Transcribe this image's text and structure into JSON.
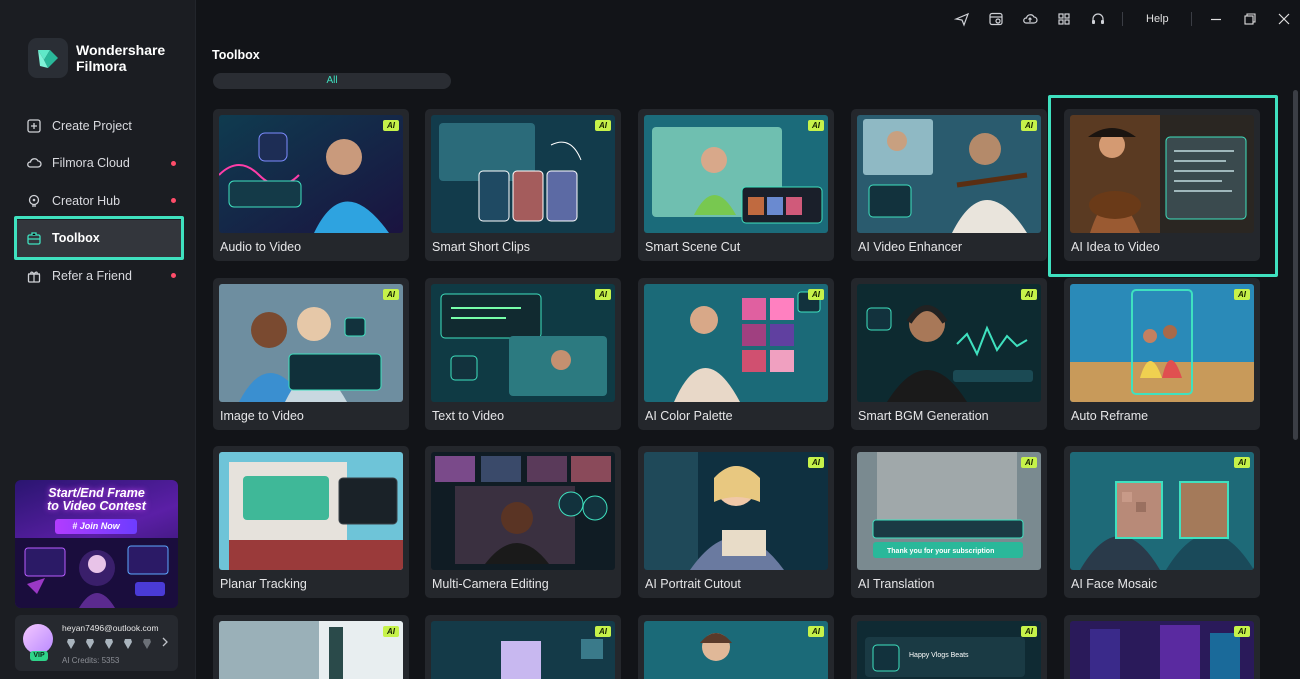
{
  "app": {
    "brand_line1": "Wondershare",
    "brand_line2": "Filmora"
  },
  "colors": {
    "accent": "#3fe1bf",
    "ai_badge": "#c6f24a",
    "notify_dot": "#ff4d6a",
    "background": "#121418"
  },
  "sidebar": {
    "items": [
      {
        "label": "Create Project",
        "icon": "plus-square-icon",
        "dot": false,
        "active": false
      },
      {
        "label": "Filmora Cloud",
        "icon": "cloud-icon",
        "dot": true,
        "active": false
      },
      {
        "label": "Creator Hub",
        "icon": "bulb-icon",
        "dot": true,
        "active": false
      },
      {
        "label": "Toolbox",
        "icon": "toolbox-icon",
        "dot": false,
        "active": true
      },
      {
        "label": "Refer a Friend",
        "icon": "gift-icon",
        "dot": true,
        "active": false
      }
    ]
  },
  "promo": {
    "title_line1": "Start/End Frame",
    "title_line2": "to Video Contest",
    "button": "# Join Now"
  },
  "account": {
    "email": "heyan7496@outlook.com",
    "vip": "VIP",
    "credits": "AI Credits: 5353"
  },
  "topbar": {
    "icons": [
      "send-icon",
      "media-icon",
      "cloud-upload-icon",
      "apps-grid-icon",
      "headset-icon"
    ],
    "help": "Help",
    "window": [
      "minimize-icon",
      "restore-icon",
      "close-icon"
    ]
  },
  "main": {
    "title": "Toolbox",
    "filter": "All",
    "ai_badge": "AI",
    "tools": [
      {
        "label": "Audio to Video",
        "ai": true
      },
      {
        "label": "Smart Short Clips",
        "ai": true
      },
      {
        "label": "Smart Scene Cut",
        "ai": true
      },
      {
        "label": "AI Video Enhancer",
        "ai": true
      },
      {
        "label": "AI Idea to Video",
        "ai": false,
        "selected": true
      },
      {
        "label": "Image to Video",
        "ai": true
      },
      {
        "label": "Text to Video",
        "ai": true
      },
      {
        "label": "AI Color Palette",
        "ai": true
      },
      {
        "label": "Smart BGM Generation",
        "ai": true
      },
      {
        "label": "Auto Reframe",
        "ai": true
      },
      {
        "label": "Planar Tracking",
        "ai": false
      },
      {
        "label": "Multi-Camera Editing",
        "ai": false
      },
      {
        "label": "AI Portrait Cutout",
        "ai": true
      },
      {
        "label": "AI Translation",
        "ai": true
      },
      {
        "label": "AI Face Mosaic",
        "ai": true
      }
    ],
    "translation_caption": "Thank you for your subscription",
    "bgm_card_title": "Happy Vlogs Beats"
  }
}
